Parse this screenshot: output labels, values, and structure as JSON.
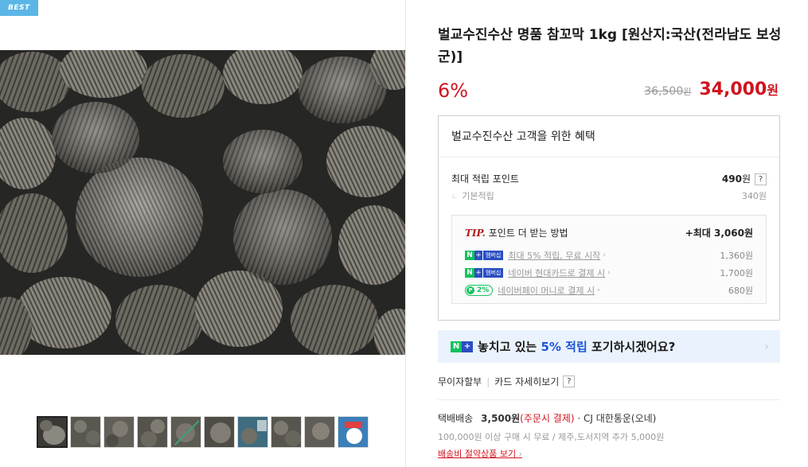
{
  "badge": "BEST",
  "product": {
    "title": "벌교수진수산 명품 참꼬막 1kg [원산지:국산(전라남도 보성군)]",
    "discount": "6%",
    "original_price": "36,500",
    "original_unit": "원",
    "sale_price": "34,000",
    "sale_unit": "원"
  },
  "benefit": {
    "header": "벌교수진수산 고객을 위한 혜택",
    "max_points_label": "최대 적립 포인트",
    "max_points_value": "490",
    "max_points_unit": "원",
    "help_label": "?",
    "base_points_label": "기본적립",
    "base_points_value": "340원",
    "tip": {
      "label": "TIP.",
      "title": "포인트 더 받는 방법",
      "max_text": "+최대 3,060원",
      "items": [
        {
          "badge_n": "N",
          "badge_plus": "+",
          "badge_member": "멤버십",
          "text": "최대 5% 적립, 무료 시작",
          "value": "1,360원"
        },
        {
          "badge_n": "N",
          "badge_plus": "+",
          "badge_member": "멤버십",
          "text": "네이버 현대카드로 결제 시",
          "value": "1,700원"
        },
        {
          "badge_circle": "P",
          "badge_pct": "2%",
          "text": "네이버페이 머니로 결제 시",
          "value": "680원"
        }
      ]
    }
  },
  "banner": {
    "badge_n": "N",
    "badge_plus": "+",
    "text_before": "놓치고 있는",
    "highlight": "5% 적립",
    "text_after": "포기하시겠어요?"
  },
  "pay_links": {
    "installment": "무이자할부",
    "card_detail": "카드 자세히보기",
    "help": "?"
  },
  "shipping": {
    "label": "택배배송",
    "fee": "3,500원",
    "fee_note": "(주문시 결제)",
    "carrier": "· CJ 대한통운(오네)",
    "condition": "100,000원 이상 구매 시 무료 / 제주,도서지역 추가 5,000원",
    "save_link": "배송비 절약상품 보기"
  },
  "colors": {
    "accent_red": "#d0141e",
    "badge_blue": "#5bb6e6",
    "naver_green": "#14c25d",
    "membership_blue": "#2a4ec2",
    "banner_bg": "#eaf3fd"
  },
  "thumbnails_count": 10
}
